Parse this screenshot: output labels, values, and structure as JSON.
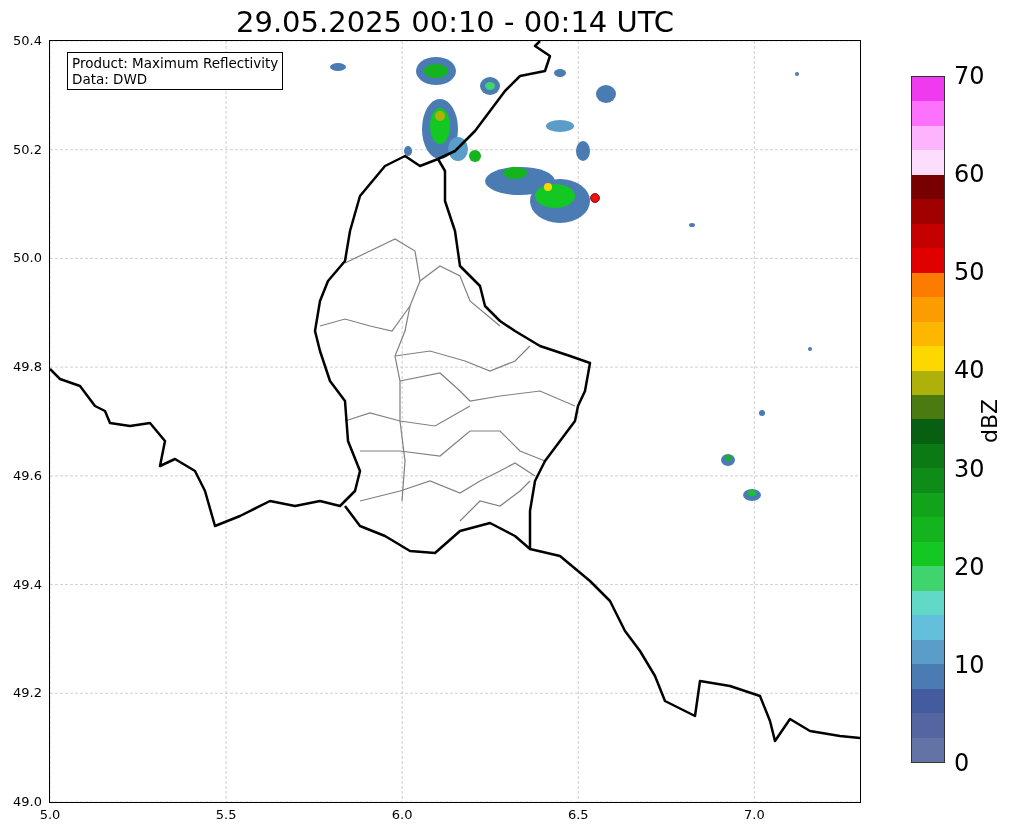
{
  "title": "29.05.2025 00:10 - 00:14 UTC",
  "info_box": [
    "Product: Maximum Reflectivity",
    "Data: DWD"
  ],
  "map": {
    "xticks": [
      "5.0",
      "5.5",
      "6.0",
      "6.5",
      "7.0"
    ],
    "yticks": [
      "50.4",
      "50.2",
      "50.0",
      "49.8",
      "49.6",
      "49.4",
      "49.2",
      "49.0"
    ]
  },
  "colorbar": {
    "label": "dBZ",
    "ticks": [
      "70",
      "60",
      "50",
      "40",
      "30",
      "20",
      "10",
      "0"
    ],
    "bands": [
      {
        "color": "#6373a6"
      },
      {
        "color": "#5466a2"
      },
      {
        "color": "#435c9f"
      },
      {
        "color": "#4b7bb3"
      },
      {
        "color": "#5a9dc8"
      },
      {
        "color": "#63bfdb"
      },
      {
        "color": "#62d8c8"
      },
      {
        "color": "#3fd46e"
      },
      {
        "color": "#14c823"
      },
      {
        "color": "#14b41e"
      },
      {
        "color": "#11a31a"
      },
      {
        "color": "#0e8c17"
      },
      {
        "color": "#0c7a14"
      },
      {
        "color": "#085e11"
      },
      {
        "color": "#4a7a10"
      },
      {
        "color": "#afb10b"
      },
      {
        "color": "#fdd800"
      },
      {
        "color": "#fdb700"
      },
      {
        "color": "#fd9c00"
      },
      {
        "color": "#fd7b00"
      },
      {
        "color": "#e10000"
      },
      {
        "color": "#c40000"
      },
      {
        "color": "#a00000"
      },
      {
        "color": "#780000"
      },
      {
        "color": "#fdddfd"
      },
      {
        "color": "#fdb4fd"
      },
      {
        "color": "#fd72fd"
      },
      {
        "color": "#f03af0"
      }
    ]
  }
}
